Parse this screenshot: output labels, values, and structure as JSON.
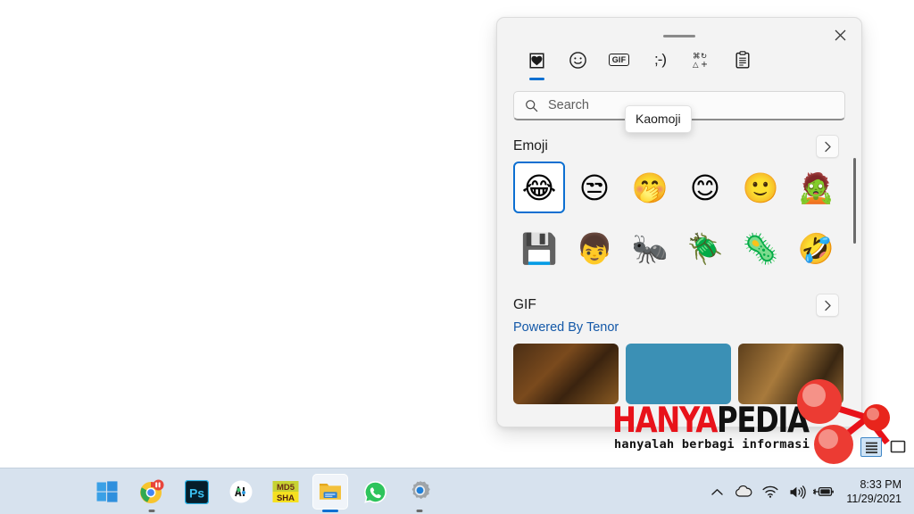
{
  "panel": {
    "close_label": "Close",
    "drag_handle_label": "Drag handle",
    "tabs": [
      {
        "id": "recent",
        "label": "Recently used",
        "icon": "clipboard-heart-icon",
        "active": true
      },
      {
        "id": "emoji",
        "label": "Emoji",
        "icon": "smiley-icon",
        "active": false
      },
      {
        "id": "gif",
        "label": "GIF",
        "icon": "gif-icon",
        "active": false,
        "text": "GIF"
      },
      {
        "id": "kaomoji",
        "label": "Kaomoji",
        "icon": "kaomoji-icon",
        "active": false,
        "text": ";-)"
      },
      {
        "id": "symbols",
        "label": "Symbols",
        "icon": "symbols-icon",
        "active": false
      },
      {
        "id": "clipboard",
        "label": "Clipboard",
        "icon": "clipboard-icon",
        "active": false
      }
    ],
    "tooltip": {
      "text": "Kaomoji"
    },
    "search": {
      "placeholder": "Search",
      "value": "",
      "icon": "search-icon"
    },
    "sections": [
      {
        "id": "emoji",
        "title": "Emoji",
        "more_label": "›",
        "items": [
          {
            "glyph": "😂",
            "name": "face-with-tears-of-joy",
            "selected": true
          },
          {
            "glyph": "😒",
            "name": "unamused-face",
            "selected": false
          },
          {
            "glyph": "🤭",
            "name": "face-with-hand-over-mouth",
            "selected": false
          },
          {
            "glyph": "😊",
            "name": "smiling-face-with-smiling-eyes",
            "selected": false
          },
          {
            "glyph": "🙂",
            "name": "slightly-smiling-face",
            "selected": false
          },
          {
            "glyph": "🧟",
            "name": "zombie",
            "selected": false
          },
          {
            "glyph": "💾",
            "name": "floppy-disk",
            "selected": false
          },
          {
            "glyph": "👦",
            "name": "boy",
            "selected": false
          },
          {
            "glyph": "🐜",
            "name": "ant",
            "selected": false
          },
          {
            "glyph": "🪲",
            "name": "beetle",
            "selected": false
          },
          {
            "glyph": "🦠",
            "name": "microbe",
            "selected": false
          },
          {
            "glyph": "🤣",
            "name": "rolling-on-the-floor-laughing",
            "selected": false
          }
        ]
      },
      {
        "id": "gif",
        "title": "GIF",
        "more_label": "›",
        "powered_by": "Powered By Tenor",
        "thumbnails": [
          {
            "name": "gif-thumbnail-1",
            "tone": "t1"
          },
          {
            "name": "gif-thumbnail-2",
            "tone": "t2"
          },
          {
            "name": "gif-thumbnail-3",
            "tone": "t3"
          }
        ]
      }
    ]
  },
  "watermark": {
    "title_part1": "HANYA",
    "title_part2": "PEDIA",
    "tagline": "hanyalah berbagi informasi",
    "color_red": "#e8121a",
    "color_black": "#111111"
  },
  "mini_icons": [
    {
      "name": "list-view-icon",
      "active": true
    },
    {
      "name": "monitor-icon",
      "active": false
    }
  ],
  "taskbar": {
    "items": [
      {
        "id": "start",
        "label": "Start",
        "icon": "windows-logo-icon",
        "active": false,
        "running": false
      },
      {
        "id": "chrome",
        "label": "Google Chrome",
        "icon": "chrome-icon",
        "active": false,
        "running": true
      },
      {
        "id": "photoshop",
        "label": "Photoshop",
        "icon": "photoshop-icon",
        "active": false,
        "running": false
      },
      {
        "id": "ai-app",
        "label": "AI App",
        "icon": "ai-app-icon",
        "active": false,
        "running": false
      },
      {
        "id": "md5sha",
        "label": "MD5 & SHA Checksum",
        "icon": "md5-sha-icon",
        "active": false,
        "running": false,
        "text_top": "MD5",
        "text_bottom": "SHA"
      },
      {
        "id": "explorer",
        "label": "File Explorer",
        "icon": "file-explorer-icon",
        "active": true,
        "running": true
      },
      {
        "id": "whatsapp",
        "label": "WhatsApp",
        "icon": "whatsapp-icon",
        "active": false,
        "running": false
      },
      {
        "id": "settings",
        "label": "Settings",
        "icon": "settings-gear-icon",
        "active": false,
        "running": true
      }
    ],
    "tray": [
      {
        "id": "overflow",
        "label": "Show hidden icons",
        "icon": "chevron-up-icon"
      },
      {
        "id": "onedrive",
        "label": "OneDrive",
        "icon": "cloud-icon"
      },
      {
        "id": "network",
        "label": "Network",
        "icon": "wifi-icon"
      },
      {
        "id": "volume",
        "label": "Volume",
        "icon": "speaker-icon"
      },
      {
        "id": "battery",
        "label": "Battery charging",
        "icon": "battery-charging-icon"
      }
    ],
    "clock": {
      "time": "8:33 PM",
      "date": "11/29/2021"
    }
  }
}
